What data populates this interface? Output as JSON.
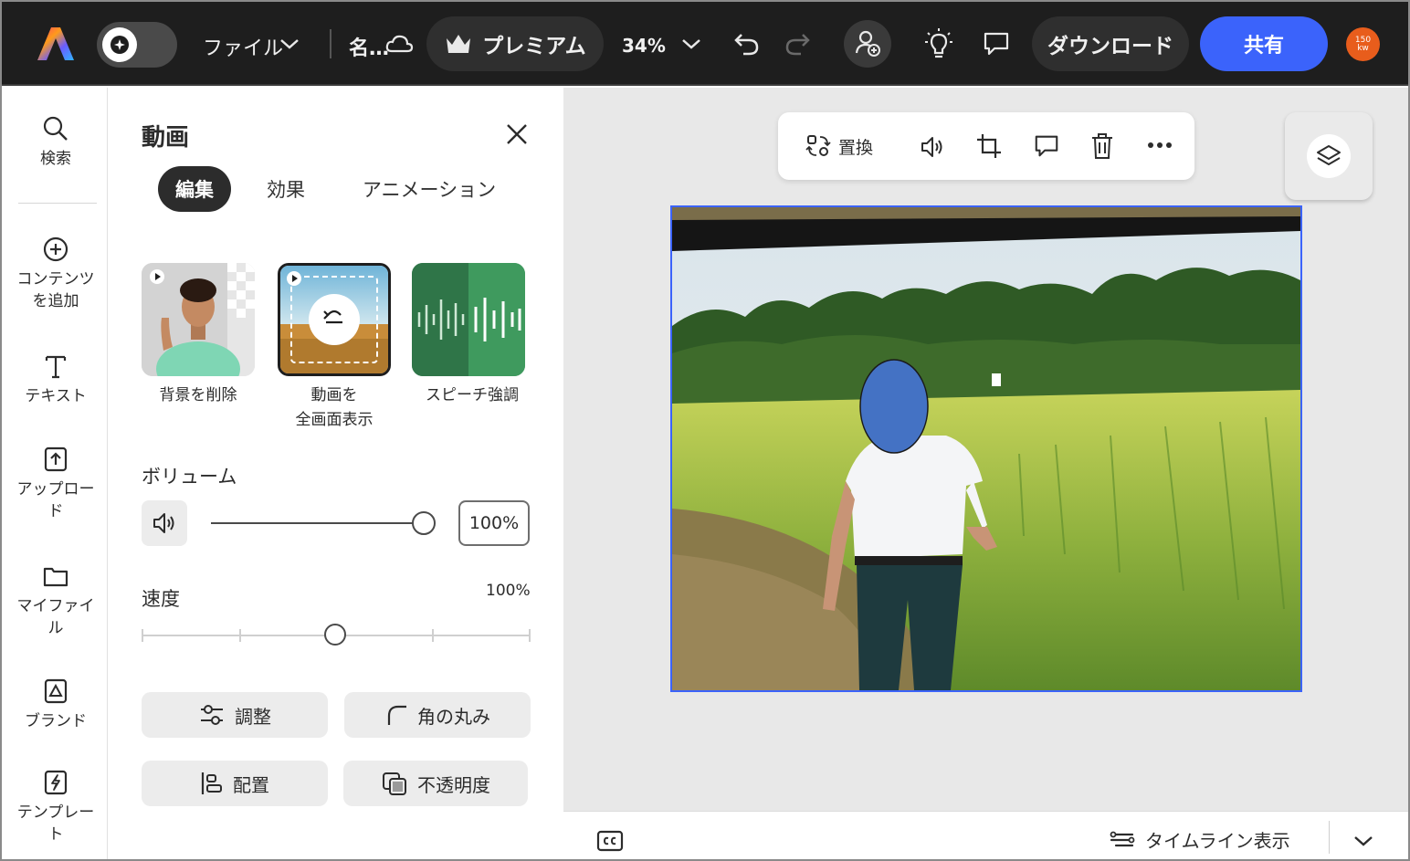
{
  "topbar": {
    "file_menu": "ファイル",
    "doc_name": "名…",
    "premium": "プレミアム",
    "zoom": "34%",
    "download": "ダウンロード",
    "share": "共有",
    "avatar_text_top": "150",
    "avatar_text_bottom": "kw"
  },
  "rail": {
    "items": [
      {
        "label": "検索",
        "icon": "search-icon"
      },
      {
        "label": "コンテンツを追加",
        "icon": "plus-circle-icon"
      },
      {
        "label": "テキスト",
        "icon": "text-icon"
      },
      {
        "label": "アップロード",
        "icon": "upload-icon"
      },
      {
        "label": "マイファイル",
        "icon": "folder-icon"
      },
      {
        "label": "ブランド",
        "icon": "brand-icon"
      },
      {
        "label": "テンプレート",
        "icon": "template-icon"
      }
    ],
    "lines": {
      "content1": "コンテンツ",
      "content2": "を追加",
      "upload1": "アップロー",
      "upload2": "ド",
      "files1": "マイファイ",
      "files2": "ル",
      "template1": "テンプレー",
      "template2": "ト"
    }
  },
  "panel": {
    "title": "動画",
    "tabs": [
      "編集",
      "効果",
      "アニメーション"
    ],
    "features": [
      {
        "label_line1": "背景を削除",
        "label_line2": ""
      },
      {
        "label_line1": "動画を",
        "label_line2": "全画面表示"
      },
      {
        "label_line1": "スピーチ強調",
        "label_line2": ""
      }
    ],
    "volume_label": "ボリューム",
    "volume_value": "100%",
    "volume_level": 1.0,
    "speed_label": "速度",
    "speed_value": "100%",
    "speed_level": 0.5,
    "buttons": {
      "adjust": "調整",
      "corner": "角の丸み",
      "align": "配置",
      "opacity": "不透明度"
    }
  },
  "context_bar": {
    "replace": "置換"
  },
  "bottombar": {
    "timeline": "タイムライン表示"
  },
  "colors": {
    "accent": "#3b63fb",
    "topbar": "#1e1e1e",
    "avatar": "#e85d1c"
  }
}
